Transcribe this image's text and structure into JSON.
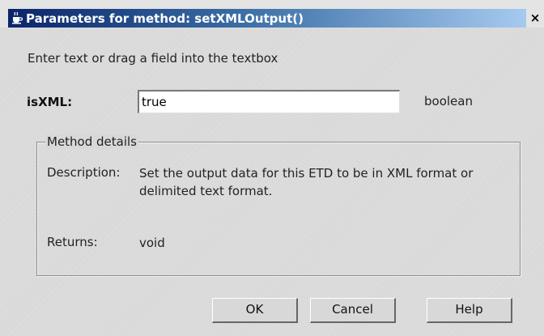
{
  "window": {
    "title": "Parameters for method: setXMLOutput()",
    "close_label": "×"
  },
  "instruction": "Enter text or drag a field into the textbox",
  "parameter": {
    "name": "isXML:",
    "value": "true",
    "type": "boolean"
  },
  "details": {
    "legend": "Method details",
    "description_label": "Description:",
    "description_text": "Set the output data for this ETD to be in XML format or delimited text format.",
    "returns_label": "Returns:",
    "returns_value": "void"
  },
  "buttons": {
    "ok": "OK",
    "cancel": "Cancel",
    "help": "Help"
  },
  "icons": {
    "app": "java-cup-icon",
    "close": "close-icon"
  }
}
